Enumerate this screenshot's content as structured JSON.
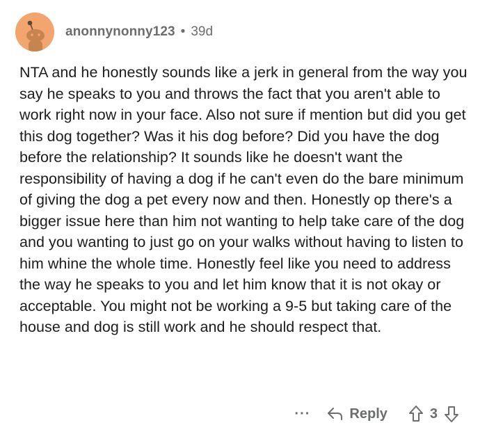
{
  "comment": {
    "username": "anonnynonny123",
    "separator": "•",
    "age": "39d",
    "text": "NTA and he honestly sounds like a jerk in general from the way you say he speaks to you and throws the fact that you aren't able to work right now in your face. Also not sure if mention but did you get this dog together? Was it his dog before? Did you have the dog before the relationship? It sounds like he doesn't want the responsibility of having a dog if he can't even do the bare minimum of giving the dog a pet every now and then. Honestly op there's a bigger issue here than him not wanting to help take care of the dog and you wanting to just go on your walks without having to listen to him whine the whole time. Honestly feel like you need to address the way he speaks to you and let him know that it is not okay or acceptable. You might not be working a 9-5 but taking care of the house and dog is still work and he should respect that."
  },
  "actions": {
    "more_label": "···",
    "reply_label": "Reply",
    "vote_count": "3"
  },
  "icons": {
    "avatar": "reddit-snoo-avatar",
    "reply": "reply-arrow-icon",
    "upvote": "upvote-arrow-icon",
    "downvote": "downvote-arrow-icon"
  },
  "colors": {
    "avatar_bg": "#f2a56e",
    "meta_text": "#6b6c6e",
    "body_text": "#1c1c1c"
  }
}
